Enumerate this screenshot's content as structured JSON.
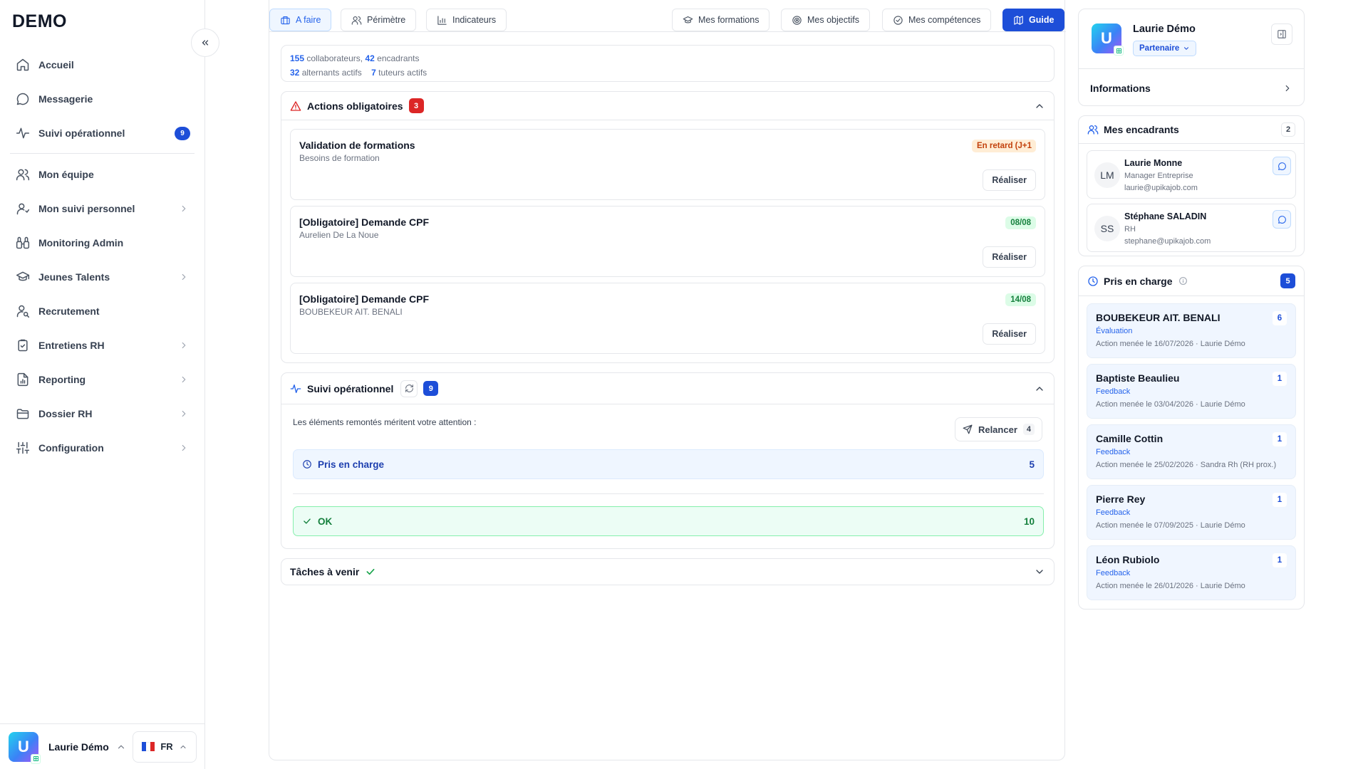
{
  "app": {
    "logo": "DEMO"
  },
  "sidebar": {
    "items": [
      {
        "label": "Accueil",
        "icon": "home-icon"
      },
      {
        "label": "Messagerie",
        "icon": "message-icon"
      },
      {
        "label": "Suivi opérationnel",
        "icon": "activity-icon",
        "badge": "9"
      },
      {
        "label": "Mon équipe",
        "icon": "users-icon"
      },
      {
        "label": "Mon suivi personnel",
        "icon": "user-icon"
      },
      {
        "label": "Monitoring Admin",
        "icon": "binoculars-icon"
      },
      {
        "label": "Jeunes Talents",
        "icon": "graduation-cap-icon"
      },
      {
        "label": "Recrutement",
        "icon": "user-search-icon"
      },
      {
        "label": "Entretiens RH",
        "icon": "clipboard-icon"
      },
      {
        "label": "Reporting",
        "icon": "file-chart-icon"
      },
      {
        "label": "Dossier RH",
        "icon": "folder-icon"
      },
      {
        "label": "Configuration",
        "icon": "sliders-icon"
      }
    ],
    "user": {
      "name": "Laurie Démo",
      "avatar": "U"
    },
    "lang": "FR"
  },
  "tabs": {
    "a_faire": "A faire",
    "perimetre": "Périmètre",
    "indicateurs": "Indicateurs",
    "mes_formations": "Mes formations",
    "mes_objectifs": "Mes objectifs",
    "mes_competences": "Mes compétences",
    "guide": "Guide"
  },
  "stats": {
    "collab_n": "155",
    "collab_l": "collaborateurs,",
    "enc_n": "42",
    "enc_l": "encadrants",
    "alt_n": "32",
    "alt_l": "alternants actifs",
    "tut_n": "7",
    "tut_l": "tuteurs actifs"
  },
  "actions": {
    "title": "Actions obligatoires",
    "count": "3",
    "button": "Réaliser",
    "items": [
      {
        "title": "Validation de formations",
        "subtitle": "Besoins de formation",
        "tag": "En retard (J+1"
      },
      {
        "title": "[Obligatoire] Demande CPF",
        "subtitle": "Aurelien De La Noue",
        "tag": "08/08"
      },
      {
        "title": "[Obligatoire] Demande CPF",
        "subtitle": "BOUBEKEUR AIT. BENALI",
        "tag": "14/08"
      }
    ]
  },
  "suivi": {
    "title": "Suivi opérationnel",
    "count": "9",
    "text": "Les éléments remontés méritent votre attention :",
    "relancer": "Relancer",
    "relancer_count": "4",
    "pris": {
      "label": "Pris en charge",
      "count": "5"
    },
    "ok": {
      "label": "OK",
      "count": "10"
    }
  },
  "taches": {
    "title": "Tâches à venir"
  },
  "profile": {
    "name": "Laurie Démo",
    "badge": "Partenaire",
    "info": "Informations"
  },
  "encadrants": {
    "title": "Mes encadrants",
    "count": "2",
    "items": [
      {
        "initials": "LM",
        "name": "Laurie Monne",
        "role": "Manager Entreprise",
        "email": "laurie@upikajob.com"
      },
      {
        "initials": "SS",
        "name": "Stéphane SALADIN",
        "role": "RH",
        "email": "stephane@upikajob.com"
      }
    ]
  },
  "pec": {
    "title": "Pris en charge",
    "count": "5",
    "items": [
      {
        "name": "BOUBEKEUR AIT. BENALI",
        "kind": "Évaluation",
        "meta": "Action menée le 16/07/2026 · Laurie Démo",
        "count": "6"
      },
      {
        "name": "Baptiste Beaulieu",
        "kind": "Feedback",
        "meta": "Action menée le 03/04/2026 · Laurie Démo",
        "count": "1"
      },
      {
        "name": "Camille Cottin",
        "kind": "Feedback",
        "meta": "Action menée le 25/02/2026 · Sandra Rh (RH prox.)",
        "count": "1"
      },
      {
        "name": "Pierre Rey",
        "kind": "Feedback",
        "meta": "Action menée le 07/09/2025 · Laurie Démo",
        "count": "1"
      },
      {
        "name": "Léon Rubiolo",
        "kind": "Feedback",
        "meta": "Action menée le 26/01/2026 · Laurie Démo",
        "count": "1"
      }
    ]
  },
  "colors": {
    "accent": "#1d4ed8",
    "danger": "#dc2626",
    "success": "#15803d",
    "late": "#c2410c"
  }
}
